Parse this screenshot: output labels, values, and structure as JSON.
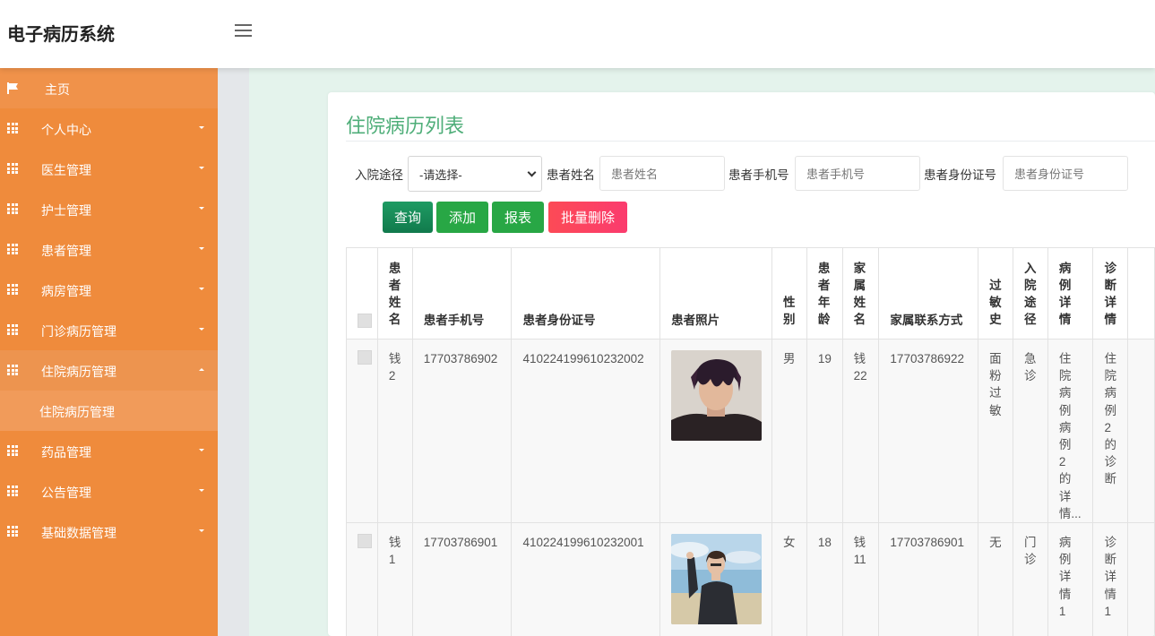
{
  "app": {
    "title": "电子病历系统"
  },
  "sidebar": {
    "home": "主页",
    "items": [
      {
        "label": "个人中心"
      },
      {
        "label": "医生管理"
      },
      {
        "label": "护士管理"
      },
      {
        "label": "患者管理"
      },
      {
        "label": "病房管理"
      },
      {
        "label": "门诊病历管理"
      },
      {
        "label": "住院病历管理",
        "expanded": true,
        "children": [
          "住院病历管理"
        ]
      },
      {
        "label": "药品管理"
      },
      {
        "label": "公告管理"
      },
      {
        "label": "基础数据管理"
      }
    ]
  },
  "page": {
    "title": "住院病历列表"
  },
  "filters": {
    "admission_label": "入院途径",
    "admission_value": "-请选择-",
    "name_label": "患者姓名",
    "name_placeholder": "患者姓名",
    "phone_label": "患者手机号",
    "phone_placeholder": "患者手机号",
    "idcard_label": "患者身份证号",
    "idcard_placeholder": "患者身份证号"
  },
  "buttons": {
    "query": "查询",
    "add": "添加",
    "report": "报表",
    "batch_delete": "批量删除"
  },
  "colors": {
    "sidebar": "#ef8b3c",
    "title": "#4fae79",
    "query": "#1e9b63",
    "add": "#28a745",
    "report": "#28a745",
    "delete": "#fc4a56"
  },
  "table": {
    "headers": [
      "患者姓名",
      "患者手机号",
      "患者身份证号",
      "患者照片",
      "性别",
      "患者年龄",
      "家属姓名",
      "家属联系方式",
      "过敏史",
      "入院途径",
      "病例详情",
      "诊断详情"
    ],
    "rows": [
      {
        "name": "钱2",
        "phone": "17703786902",
        "idcard": "410224199610232002",
        "photo": "portrait-dark-hair",
        "gender": "男",
        "age": "19",
        "family_name": "钱22",
        "family_phone": "17703786922",
        "allergy": "面粉过敏",
        "admission": "急诊",
        "case": "住院病例病例2的详情...",
        "diagnosis": "住院病例2的诊断"
      },
      {
        "name": "钱1",
        "phone": "17703786901",
        "idcard": "410224199610232001",
        "photo": "portrait-beach",
        "gender": "女",
        "age": "18",
        "family_name": "钱11",
        "family_phone": "17703786901",
        "allergy": "无",
        "admission": "门诊",
        "case": "病例详情1",
        "diagnosis": "诊断详情1"
      }
    ]
  }
}
